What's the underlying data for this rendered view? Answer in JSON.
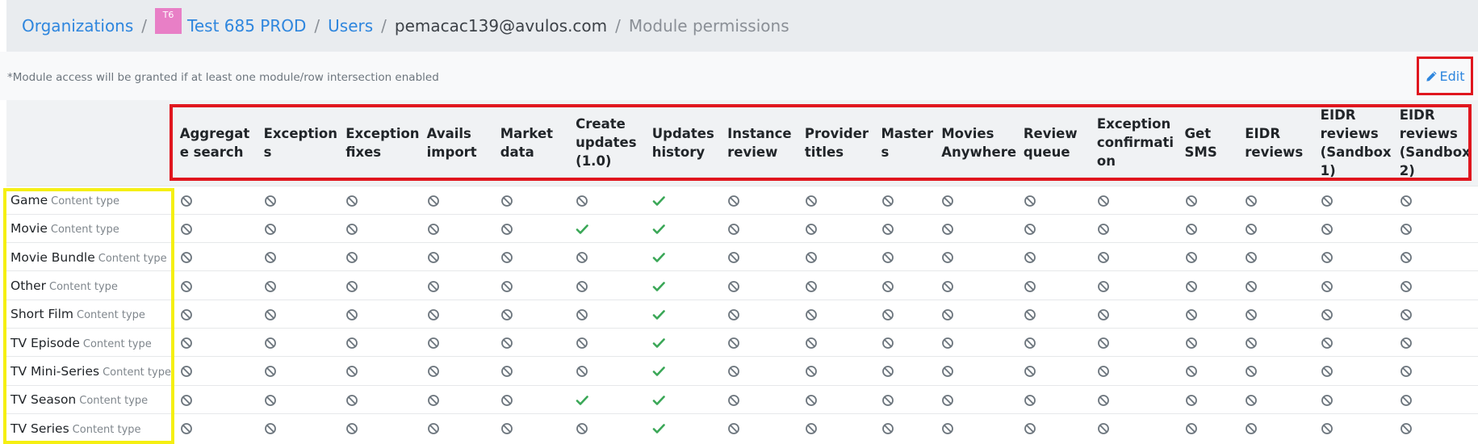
{
  "breadcrumb": {
    "organizations": "Organizations",
    "org_badge": "T6",
    "org_name": "Test 685 PROD",
    "users": "Users",
    "user_email": "pemacac139@avulos.com",
    "page": "Module permissions",
    "separator": "/"
  },
  "note": "*Module access will be granted if at least one module/row intersection enabled",
  "edit_label": "Edit",
  "modules": [
    "Aggregate search",
    "Exceptions",
    "Exception fixes",
    "Avails import",
    "Market data",
    "Create updates (1.0)",
    "Updates history",
    "Instance review",
    "Provider titles",
    "Masters",
    "Movies Anywhere",
    "Review queue",
    "Exception confirmation",
    "Get SMS",
    "EIDR reviews",
    "EIDR reviews (Sandbox 1)",
    "EIDR reviews (Sandbox 2)"
  ],
  "rows": [
    {
      "name": "Game",
      "sub": "Content type",
      "perms": [
        0,
        0,
        0,
        0,
        0,
        0,
        1,
        0,
        0,
        0,
        0,
        0,
        0,
        0,
        0,
        0,
        0
      ]
    },
    {
      "name": "Movie",
      "sub": "Content type",
      "perms": [
        0,
        0,
        0,
        0,
        0,
        1,
        1,
        0,
        0,
        0,
        0,
        0,
        0,
        0,
        0,
        0,
        0
      ]
    },
    {
      "name": "Movie Bundle",
      "sub": "Content type",
      "perms": [
        0,
        0,
        0,
        0,
        0,
        0,
        1,
        0,
        0,
        0,
        0,
        0,
        0,
        0,
        0,
        0,
        0
      ]
    },
    {
      "name": "Other",
      "sub": "Content type",
      "perms": [
        0,
        0,
        0,
        0,
        0,
        0,
        1,
        0,
        0,
        0,
        0,
        0,
        0,
        0,
        0,
        0,
        0
      ]
    },
    {
      "name": "Short Film",
      "sub": "Content type",
      "perms": [
        0,
        0,
        0,
        0,
        0,
        0,
        1,
        0,
        0,
        0,
        0,
        0,
        0,
        0,
        0,
        0,
        0
      ]
    },
    {
      "name": "TV Episode",
      "sub": "Content type",
      "perms": [
        0,
        0,
        0,
        0,
        0,
        0,
        1,
        0,
        0,
        0,
        0,
        0,
        0,
        0,
        0,
        0,
        0
      ]
    },
    {
      "name": "TV Mini-Series",
      "sub": "Content type",
      "perms": [
        0,
        0,
        0,
        0,
        0,
        0,
        1,
        0,
        0,
        0,
        0,
        0,
        0,
        0,
        0,
        0,
        0
      ]
    },
    {
      "name": "TV Season",
      "sub": "Content type",
      "perms": [
        0,
        0,
        0,
        0,
        0,
        1,
        1,
        0,
        0,
        0,
        0,
        0,
        0,
        0,
        0,
        0,
        0
      ]
    },
    {
      "name": "TV Series",
      "sub": "Content type",
      "perms": [
        0,
        0,
        0,
        0,
        0,
        0,
        1,
        0,
        0,
        0,
        0,
        0,
        0,
        0,
        0,
        0,
        0
      ]
    }
  ],
  "icons": {
    "enabled": "check-icon",
    "disabled": "ban-icon",
    "edit": "pencil-icon"
  },
  "colors": {
    "link": "#2e86de",
    "enabled": "#3aa757",
    "disabled": "#6c757d",
    "highlight_red": "#e0161e",
    "highlight_yellow": "#f5ef12",
    "badge": "#e87fc6"
  }
}
